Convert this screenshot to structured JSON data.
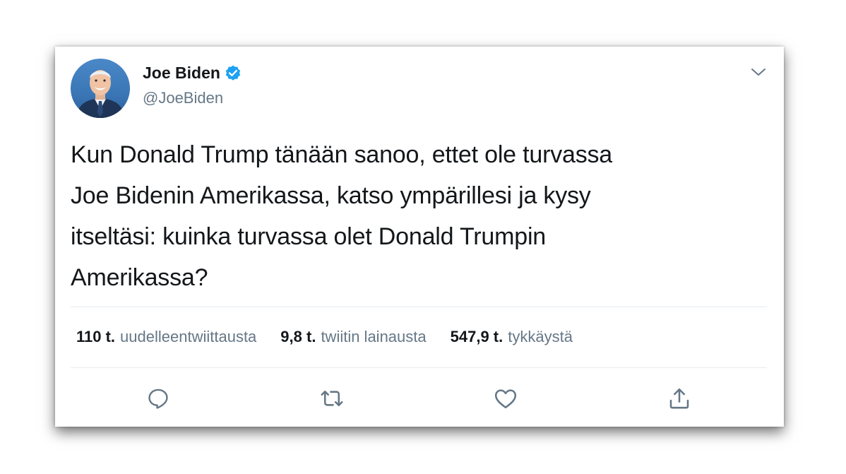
{
  "author": {
    "name": "Joe Biden",
    "handle": "@JoeBiden",
    "verified": true
  },
  "tweet": {
    "lines": [
      "Kun Donald Trump tänään sanoo, ettet ole turvassa",
      "Joe Bidenin Amerikassa, katso ympärillesi ja kysy",
      "itseltäsi: kuinka turvassa olet Donald Trumpin",
      "Amerikassa?"
    ]
  },
  "stats": [
    {
      "count": "110 t.",
      "label": "uudelleentwiittausta"
    },
    {
      "count": "9,8 t.",
      "label": "twiitin lainausta"
    },
    {
      "count": "547,9 t.",
      "label": "tykkäystä"
    }
  ],
  "icons": {
    "verified": "verified-badge-icon",
    "menu": "chevron-down-icon",
    "reply": "reply-icon",
    "retweet": "retweet-icon",
    "like": "heart-icon",
    "share": "share-icon"
  },
  "colors": {
    "text": "#14171a",
    "secondary": "#657786",
    "verified": "#1da1f2",
    "divider": "#e6ecf0"
  }
}
